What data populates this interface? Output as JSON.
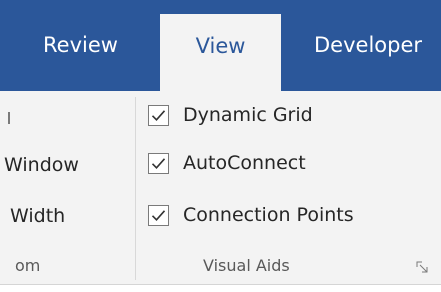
{
  "tabs": [
    {
      "label": "Review",
      "selected": false
    },
    {
      "label": "View",
      "selected": true
    },
    {
      "label": "Developer",
      "selected": false
    }
  ],
  "zoom_group": {
    "items": [
      "Window",
      "Width"
    ],
    "label": "om"
  },
  "visual_aids": {
    "label": "Visual Aids",
    "checkboxes": [
      {
        "label": "Dynamic Grid",
        "checked": true
      },
      {
        "label": "AutoConnect",
        "checked": true
      },
      {
        "label": "Connection Points",
        "checked": true
      }
    ],
    "launcher_icon": "dialog-launcher-icon"
  },
  "colors": {
    "tab_bar": "#2b579a",
    "ribbon_bg": "#f3f3f3",
    "text": "#262626"
  }
}
